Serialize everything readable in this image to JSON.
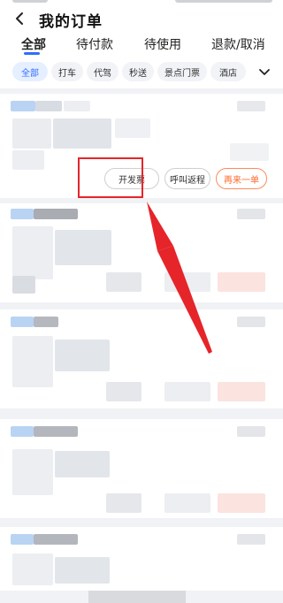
{
  "header": {
    "title": "我的订单",
    "back_icon": "back-arrow-icon"
  },
  "tabs": [
    {
      "label": "全部",
      "active": true
    },
    {
      "label": "待付款",
      "active": false
    },
    {
      "label": "待使用",
      "active": false
    },
    {
      "label": "退款/取消",
      "active": false
    }
  ],
  "chips": [
    {
      "label": "全部",
      "active": true
    },
    {
      "label": "打车",
      "active": false
    },
    {
      "label": "代驾",
      "active": false
    },
    {
      "label": "秒送",
      "active": false
    },
    {
      "label": "景点门票",
      "active": false
    },
    {
      "label": "酒店",
      "active": false
    }
  ],
  "order_actions": {
    "invoice_label": "开发票",
    "call_driver_label": "呼叫返程",
    "reorder_label": "再来一单"
  },
  "colors": {
    "accent": "#2f6bff",
    "annotation": "#e5252a",
    "reorder": "#ff6a2a"
  }
}
